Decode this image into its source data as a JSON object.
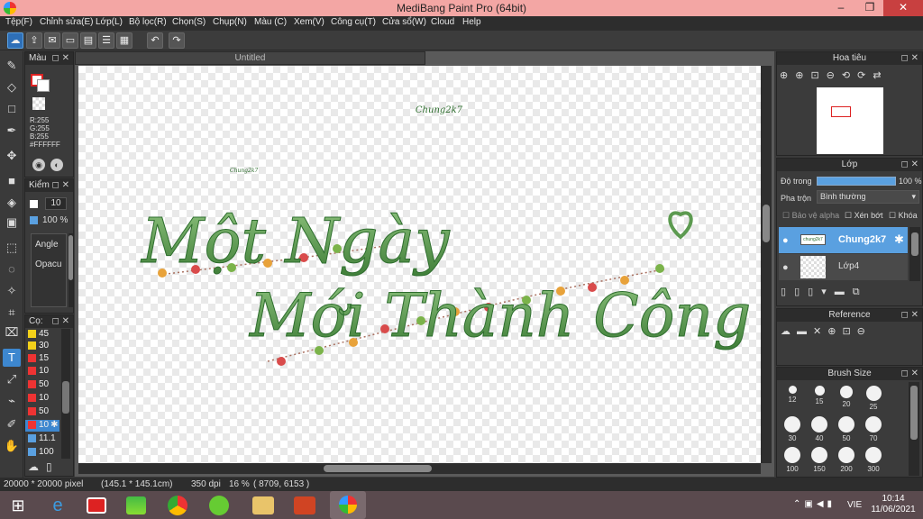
{
  "window": {
    "title": "MediBang Paint Pro (64bit)",
    "minimize": "–",
    "restore": "❐",
    "close": "✕"
  },
  "menu": [
    "Tệp(F)",
    "Chỉnh sửa(E)",
    "Lớp(L)",
    "Bộ lọc(R)",
    "Chọn(S)",
    "Chụp(N)",
    "Màu (C)",
    "Xem(V)",
    "Công cụ(T)",
    "Cửa sổ(W)",
    "Cloud",
    "Help"
  ],
  "color_panel": {
    "title": "Màu",
    "r": "R:255",
    "g": "G:255",
    "b": "B:255",
    "hex": "#FFFFFF"
  },
  "brush_panel": {
    "title": "Kiểm",
    "size": "10",
    "opacity": "100 %",
    "angle_label": "Angle",
    "opacity_label": "Opacu"
  },
  "size_panel": {
    "title": "Cọ:",
    "rows": [
      "45",
      "30",
      "15",
      "10",
      "50",
      "10",
      "50",
      "10",
      "11.1",
      "100"
    ]
  },
  "canvas": {
    "tab": "Untitled"
  },
  "artwork": {
    "signature_top": "Chung2k7",
    "signature_small": "Chung2k7",
    "line1": "Một Ngày",
    "line2": "Mới Thành Công"
  },
  "navigator": {
    "title": "Hoa tiêu"
  },
  "layers": {
    "title": "Lớp",
    "opacity_label": "Độ trong",
    "opacity_value": "100 %",
    "blend_label": "Pha trộn",
    "blend_value": "Bình thường",
    "protect_alpha": "Bảo vệ alpha",
    "clipping": "Xén bớt",
    "lock": "Khóa",
    "items": [
      {
        "name": "Chung2k7",
        "thumb": "chung2k7"
      },
      {
        "name": "Lớp4",
        "thumb": ""
      }
    ]
  },
  "reference": {
    "title": "Reference"
  },
  "brush_size": {
    "title": "Brush Size",
    "sizes": [
      "12",
      "15",
      "20",
      "25",
      "30",
      "40",
      "50",
      "70",
      "100",
      "150",
      "200",
      "300"
    ]
  },
  "status": {
    "pixels": "20000 * 20000 pixel",
    "cm": "(145.1 * 145.1cm)",
    "dpi": "350 dpi",
    "zoom": "16 %",
    "coords": "( 8709, 6153 )"
  },
  "taskbar": {
    "lang": "VIE",
    "time": "10:14",
    "date": "11/06/2021"
  }
}
